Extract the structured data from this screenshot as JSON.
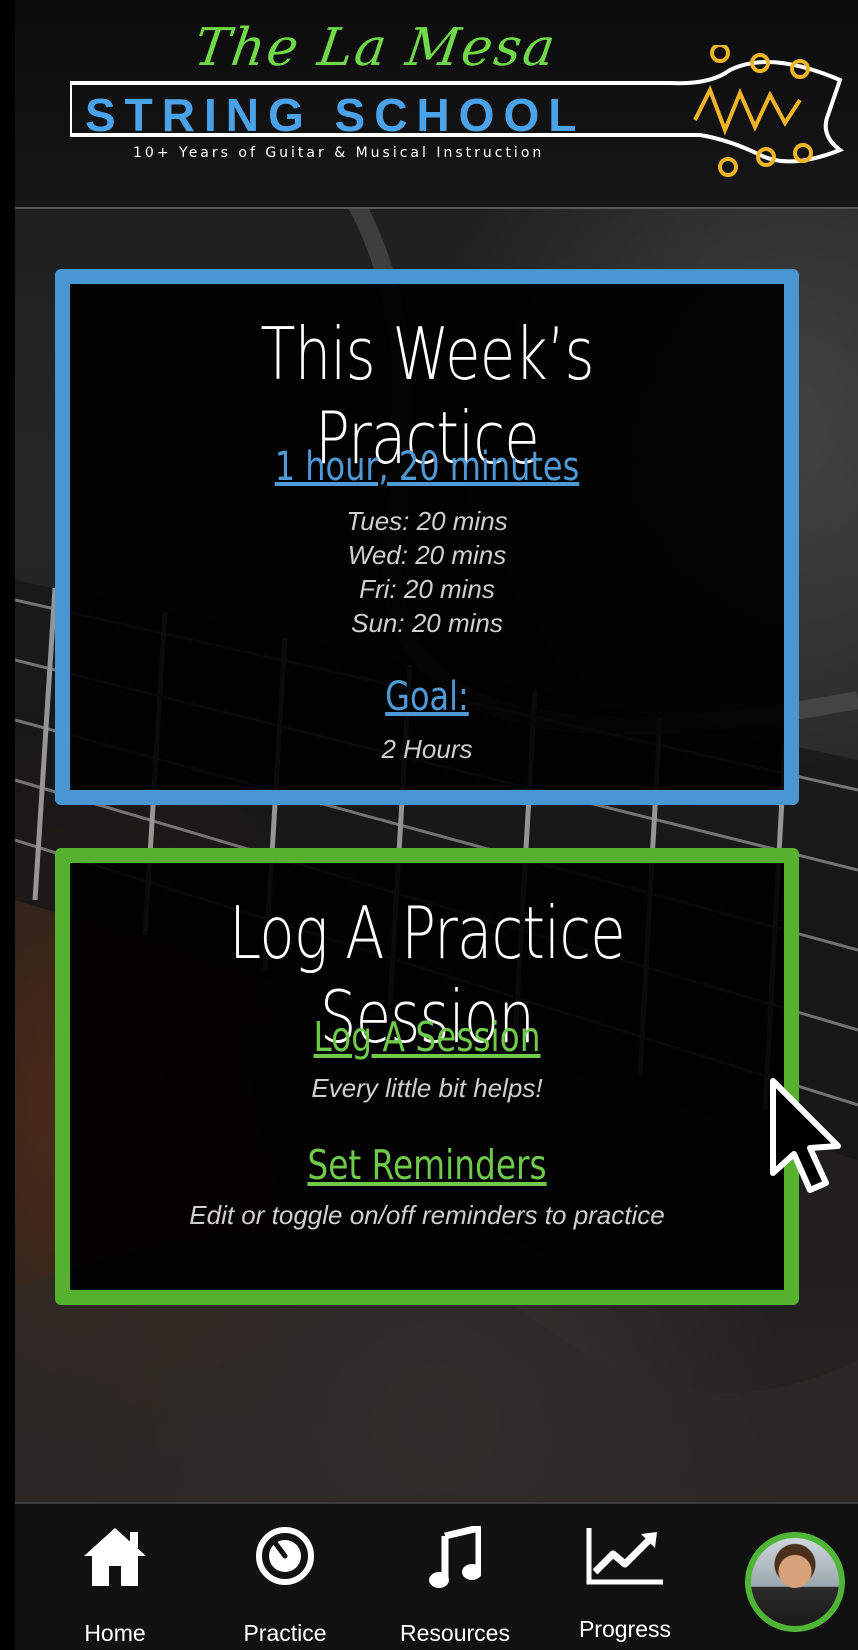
{
  "header": {
    "logo_script": "The La Mesa",
    "logo_main": "STRING SCHOOL",
    "logo_tagline": "10+ Years of Guitar & Musical Instruction"
  },
  "practice_card": {
    "title": "This Week’s Practice",
    "total_link": "1 hour, 20 minutes",
    "days": [
      "Tues: 20 mins",
      "Wed: 20 mins",
      "Fri: 20 mins",
      "Sun: 20 mins"
    ],
    "goal_link": "Goal:",
    "goal_value": "2 Hours",
    "accent": "#4996d3"
  },
  "log_card": {
    "title": "Log A Practice Session",
    "log_link": "Log A Session",
    "log_sub": "Every little bit helps!",
    "reminders_link": "Set Reminders",
    "reminders_sub": "Edit or toggle on/off reminders to practice",
    "accent": "#56b130"
  },
  "tabbar": {
    "items": [
      {
        "label": "Home",
        "icon": "home-icon"
      },
      {
        "label": "Practice",
        "icon": "timer-icon"
      },
      {
        "label": "Resources",
        "icon": "music-note-icon"
      },
      {
        "label": "Progress",
        "icon": "chart-icon"
      }
    ],
    "profile_icon": "avatar",
    "profile_ring_color": "#4fb536"
  }
}
